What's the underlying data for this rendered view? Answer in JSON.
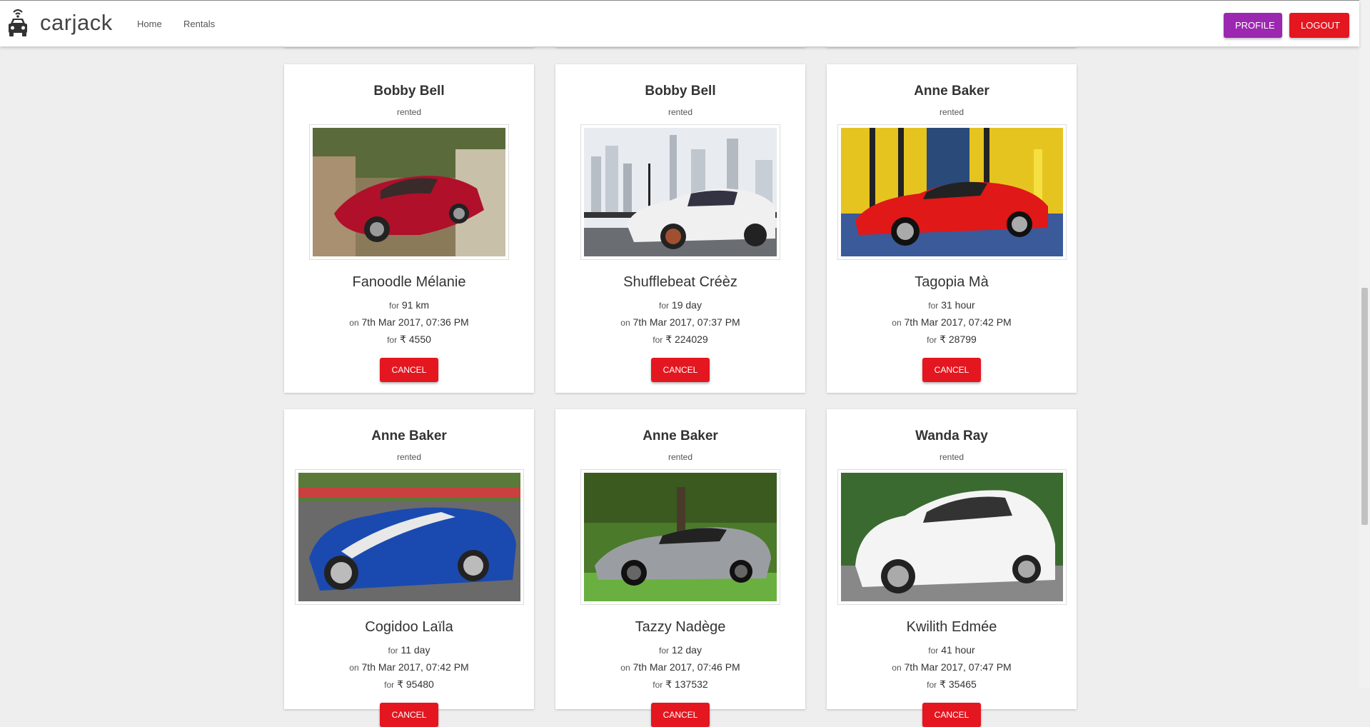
{
  "header": {
    "brand": "carjack",
    "nav": [
      "Home",
      "Rentals"
    ],
    "profile_label": "PROFILE",
    "logout_label": "LOGOUT",
    "colors": {
      "profile": "#9c27b0",
      "logout": "#e4161f"
    }
  },
  "rentals": [
    {
      "owner": "Bobby Bell",
      "status": "rented",
      "car": "Fanoodle Mélanie",
      "for_pre": "for",
      "duration": "91 km",
      "on_pre": "on",
      "date": "7th Mar 2017, 07:36 PM",
      "price_pre": "for",
      "price": "₹ 4550",
      "cancel": "CANCEL",
      "image": "red-alfa-romeo-4c"
    },
    {
      "owner": "Bobby Bell",
      "status": "rented",
      "car": "Shufflebeat Créèz",
      "for_pre": "for",
      "duration": "19 day",
      "on_pre": "on",
      "date": "7th Mar 2017, 07:37 PM",
      "price_pre": "for",
      "price": "₹ 224029",
      "cancel": "CANCEL",
      "image": "white-acura-sedan-city"
    },
    {
      "owner": "Anne Baker",
      "status": "rented",
      "car": "Tagopia Mà",
      "for_pre": "for",
      "duration": "31 hour",
      "on_pre": "on",
      "date": "7th Mar 2017, 07:42 PM",
      "price_pre": "for",
      "price": "₹ 28799",
      "cancel": "CANCEL",
      "image": "red-ferrari-458"
    },
    {
      "owner": "Anne Baker",
      "status": "rented",
      "car": "Cogidoo Laïla",
      "for_pre": "for",
      "duration": "11 day",
      "on_pre": "on",
      "date": "7th Mar 2017, 07:42 PM",
      "price_pre": "for",
      "price": "₹ 95480",
      "cancel": "CANCEL",
      "image": "blue-shelby-cobra"
    },
    {
      "owner": "Anne Baker",
      "status": "rented",
      "car": "Tazzy Nadège",
      "for_pre": "for",
      "duration": "12 day",
      "on_pre": "on",
      "date": "7th Mar 2017, 07:46 PM",
      "price_pre": "for",
      "price": "₹ 137532",
      "cancel": "CANCEL",
      "image": "silver-mercedes-amg-gt"
    },
    {
      "owner": "Wanda Ray",
      "status": "rented",
      "car": "Kwilith Edmée",
      "for_pre": "for",
      "duration": "41 hour",
      "on_pre": "on",
      "date": "7th Mar 2017, 07:47 PM",
      "price_pre": "for",
      "price": "₹ 35465",
      "cancel": "CANCEL",
      "image": "white-range-rover-evoque"
    }
  ]
}
